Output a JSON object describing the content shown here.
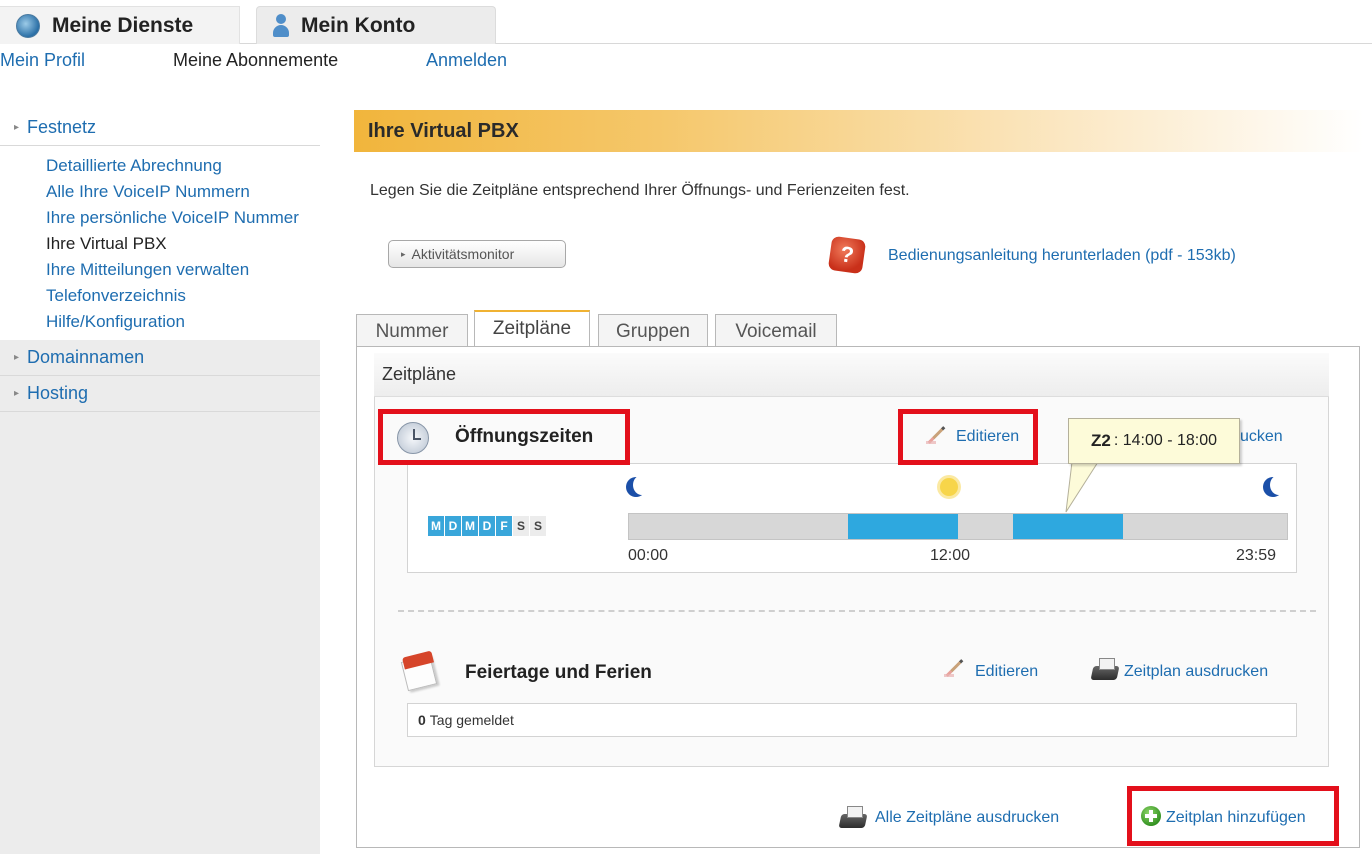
{
  "top_tabs": [
    {
      "label": "Meine Dienste",
      "icon": "globe-icon"
    },
    {
      "label": "Mein Konto",
      "icon": "user-icon"
    }
  ],
  "subnav": {
    "profil": "Mein Profil",
    "abos": "Meine Abonnemente",
    "anmelden": "Anmelden"
  },
  "sidebar": {
    "festnetz": "Festnetz",
    "items": [
      "Detaillierte Abrechnung",
      "Alle Ihre VoiceIP Nummern",
      "Ihre persönliche VoiceIP Nummer",
      "Ihre Virtual PBX",
      "Ihre Mitteilungen verwalten",
      "Telefonverzeichnis",
      "Hilfe/Konfiguration"
    ],
    "active_item": "Ihre Virtual PBX",
    "domainnamen": "Domainnamen",
    "hosting": "Hosting"
  },
  "main": {
    "title": "Ihre Virtual PBX",
    "intro": "Legen Sie die Zeitpläne entsprechend Ihrer Öffnungs- und Ferienzeiten fest.",
    "activity_button": "Aktivitätsmonitor",
    "help_link": "Bedienungsanleitung herunterladen (pdf - 153kb)"
  },
  "tabs": [
    {
      "label": "Nummer",
      "active": false
    },
    {
      "label": "Zeitpläne",
      "active": true
    },
    {
      "label": "Gruppen",
      "active": false
    },
    {
      "label": "Voicemail",
      "active": false
    }
  ],
  "zeitplaene": {
    "title": "Zeitpläne",
    "oeffnungszeiten": {
      "label": "Öffnungszeiten",
      "edit": "Editieren",
      "print_partial": "ucken",
      "days": [
        {
          "label": "M",
          "active": true
        },
        {
          "label": "D",
          "active": true
        },
        {
          "label": "M",
          "active": true
        },
        {
          "label": "D",
          "active": true
        },
        {
          "label": "F",
          "active": true
        },
        {
          "label": "S",
          "active": false
        },
        {
          "label": "S",
          "active": false
        }
      ],
      "segments": [
        {
          "start_hour": 8.0,
          "end_hour": 12.0
        },
        {
          "start_hour": 14.0,
          "end_hour": 18.0
        }
      ],
      "ticks": [
        "00:00",
        "12:00",
        "23:59"
      ],
      "tooltip": {
        "id": "Z2",
        "text": ": 14:00 - 18:00"
      }
    },
    "feiertage": {
      "label": "Feiertage und Ferien",
      "edit": "Editieren",
      "print": "Zeitplan ausdrucken",
      "count": "0",
      "count_suffix": "Tag gemeldet"
    }
  },
  "footer": {
    "print_all": "Alle Zeitpläne ausdrucken",
    "add": "Zeitplan hinzufügen"
  },
  "colors": {
    "accent": "#f0b232",
    "link": "#1e6db0",
    "bar_fill": "#2ea8df",
    "highlight": "#e3101b"
  }
}
